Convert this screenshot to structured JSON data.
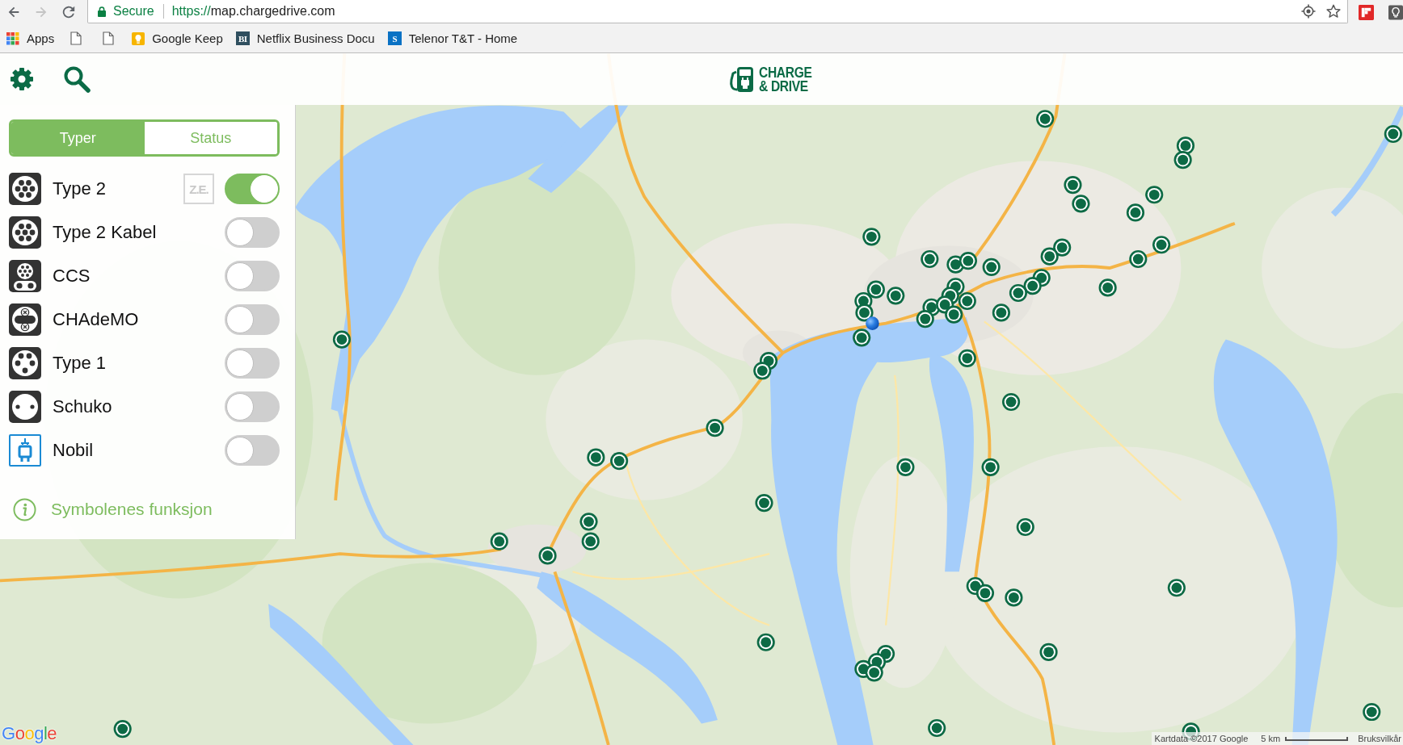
{
  "browser": {
    "nav": [
      {
        "kind": "back",
        "disabled": false
      },
      {
        "kind": "forward",
        "disabled": true
      },
      {
        "kind": "reload",
        "disabled": false
      }
    ],
    "security": "Secure",
    "url": {
      "scheme": "https://",
      "host": "map.chargedrive.com"
    },
    "extensions": [
      {
        "kind": "flipboard"
      },
      {
        "kind": "bulb"
      }
    ]
  },
  "bookmarks": [
    {
      "kind": "apps",
      "label": "Apps"
    },
    {
      "kind": "page"
    },
    {
      "kind": "page"
    },
    {
      "kind": "keep",
      "label": "Google Keep"
    },
    {
      "kind": "monogram",
      "favicon_text": "BI",
      "color": "#2f4f5f",
      "label": "Netflix Business Docu"
    },
    {
      "kind": "monogram",
      "favicon_text": "S",
      "color": "#0a72c4",
      "label": "Telenor T&T - Home"
    }
  ],
  "header": {
    "logo_lines": [
      "CHARGE",
      "& DRIVE"
    ]
  },
  "panel": {
    "tabs": [
      {
        "label": "Typer",
        "selected": true
      },
      {
        "label": "Status",
        "selected": false
      }
    ],
    "connectors": [
      {
        "kind": "type2",
        "label": "Type 2",
        "badge": "Z.E.",
        "on": true
      },
      {
        "kind": "type2_cable",
        "label": "Type 2 Kabel",
        "on": false
      },
      {
        "kind": "ccs",
        "label": "CCS",
        "on": false
      },
      {
        "kind": "chademo",
        "label": "CHAdeMO",
        "on": false
      },
      {
        "kind": "type1",
        "label": "Type 1",
        "on": false
      },
      {
        "kind": "schuko",
        "label": "Schuko",
        "on": false
      },
      {
        "kind": "nobil",
        "label": "Nobil",
        "on": false
      }
    ],
    "info_link": "Symbolenes funksjon"
  },
  "map": {
    "logo": "Google",
    "attribution": "Kartdata ©2017 Google",
    "scale": "5 km",
    "terms": "Bruksvilkår"
  }
}
